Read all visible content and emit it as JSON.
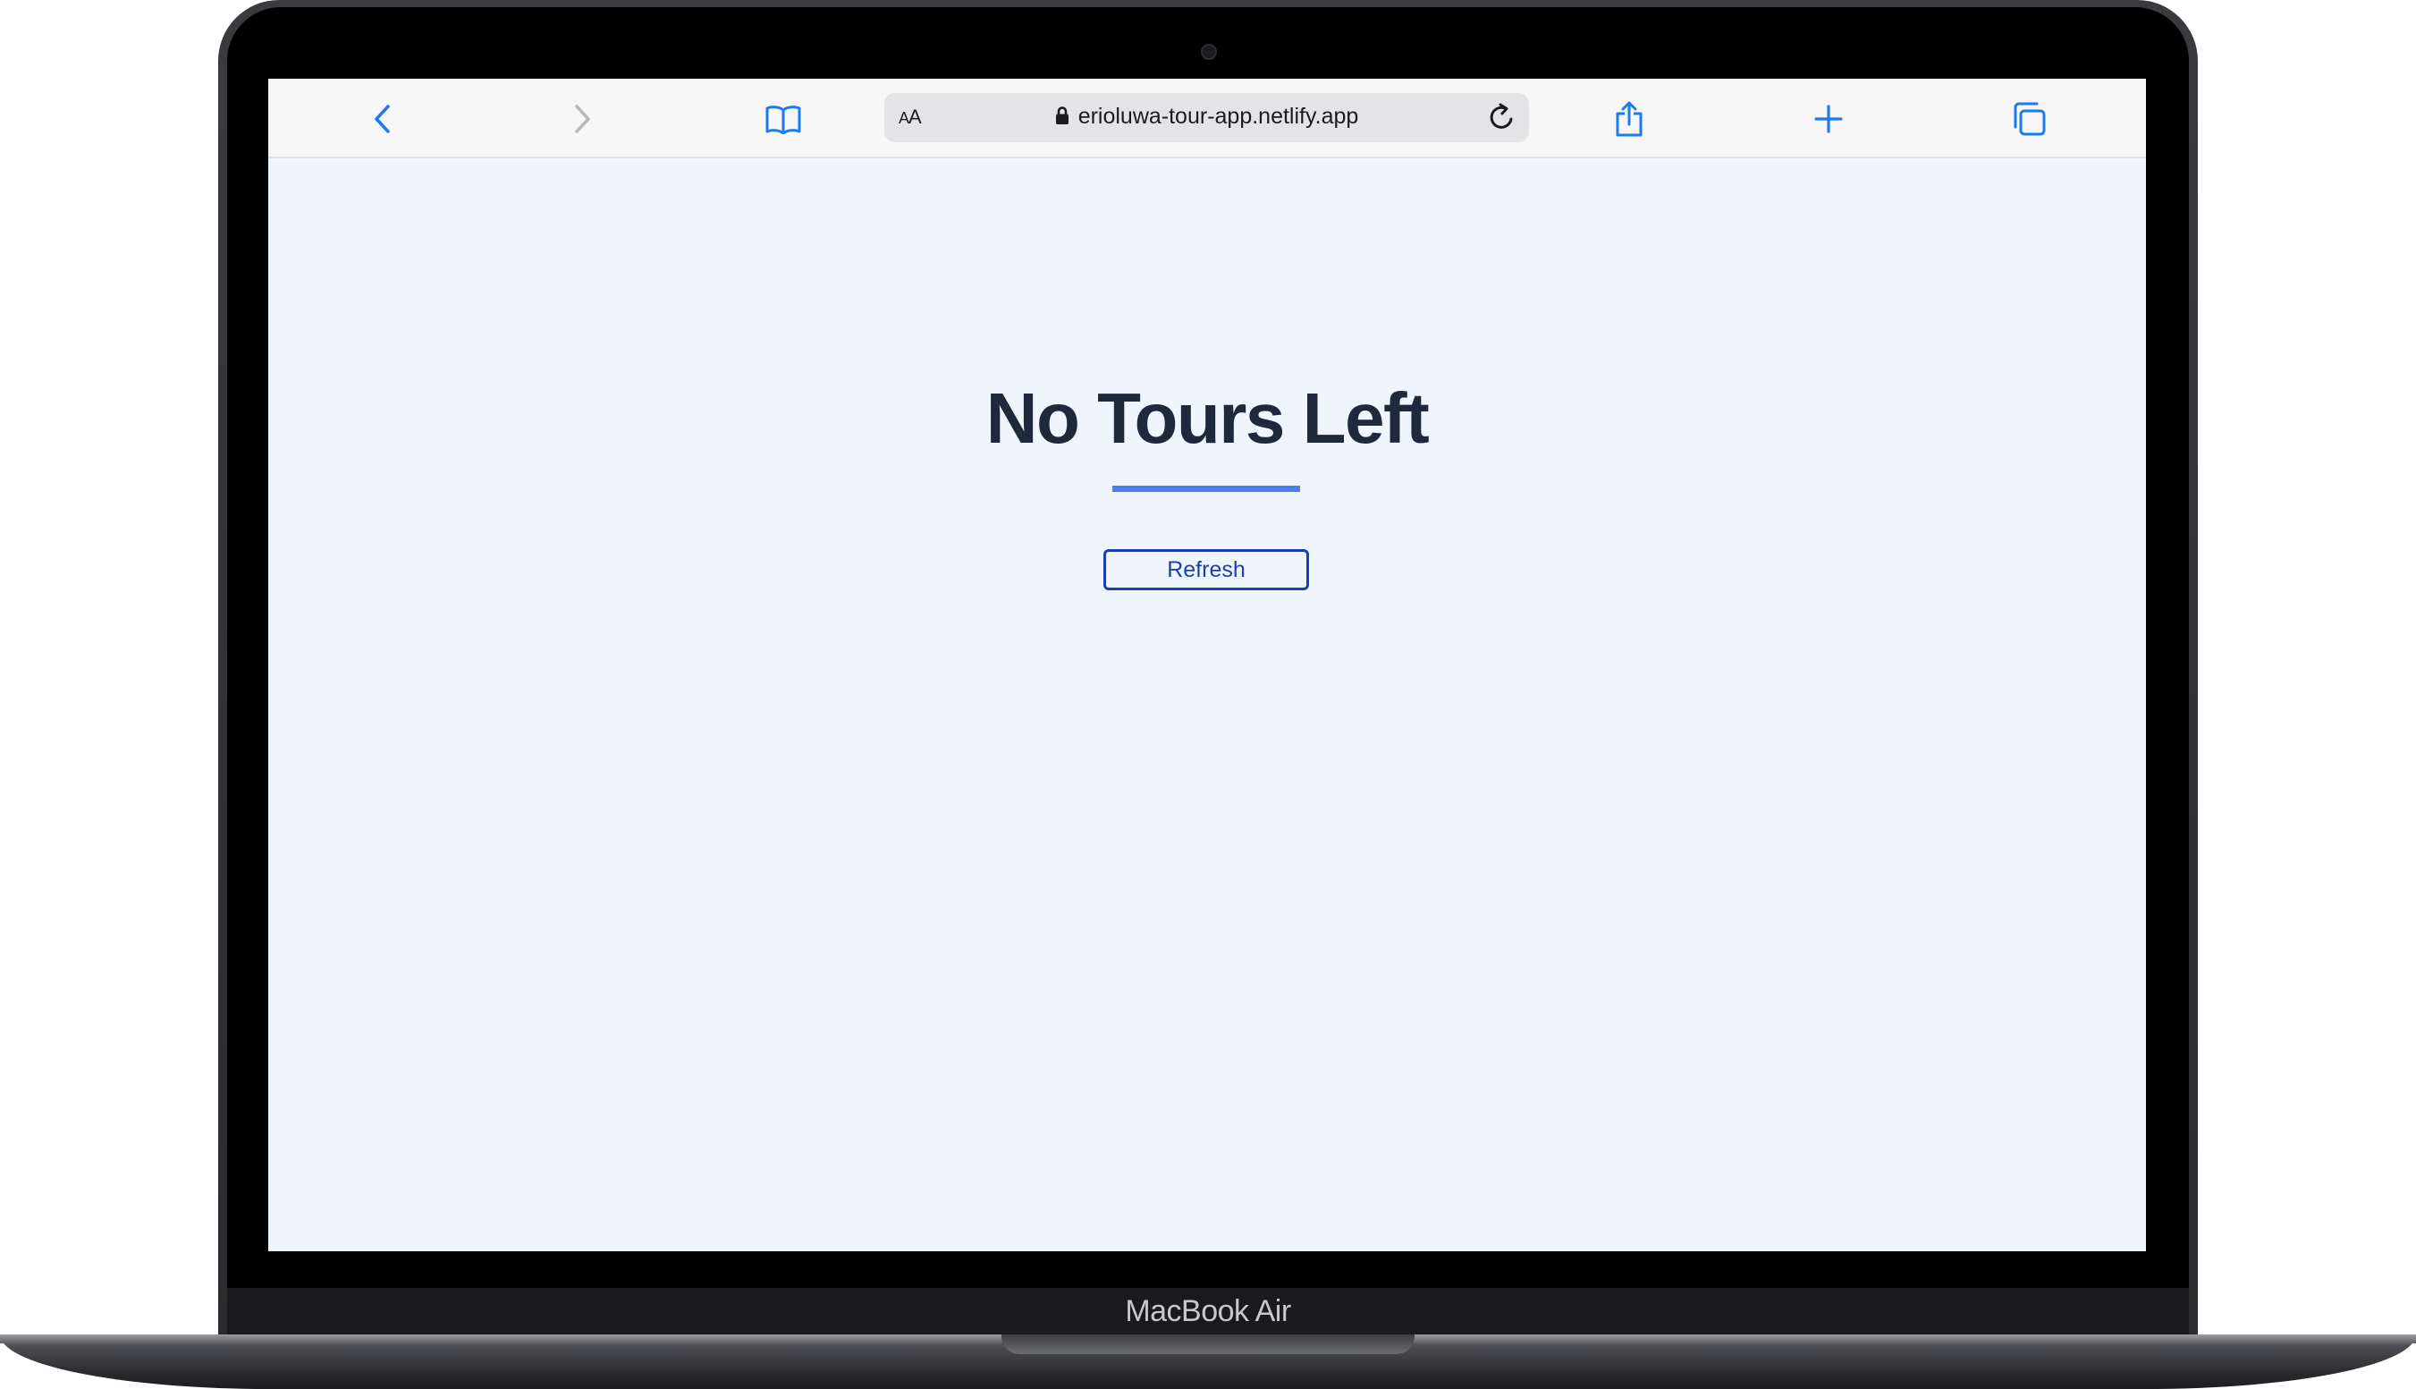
{
  "device": {
    "model_label": "MacBook Air"
  },
  "browser": {
    "text_size_label_small": "A",
    "text_size_label_large": "A",
    "url": "erioluwa-tour-app.netlify.app",
    "accent_color": "#1a7cf0",
    "icons": [
      "back-icon",
      "forward-icon",
      "bookmarks-icon",
      "lock-icon",
      "reload-icon",
      "share-icon",
      "new-tab-icon",
      "tabs-icon"
    ]
  },
  "page": {
    "title": "No Tours Left",
    "refresh_label": "Refresh",
    "background_color": "#eef5fd",
    "underline_color": "#4a7ff0",
    "button_color": "#1d3fae"
  }
}
